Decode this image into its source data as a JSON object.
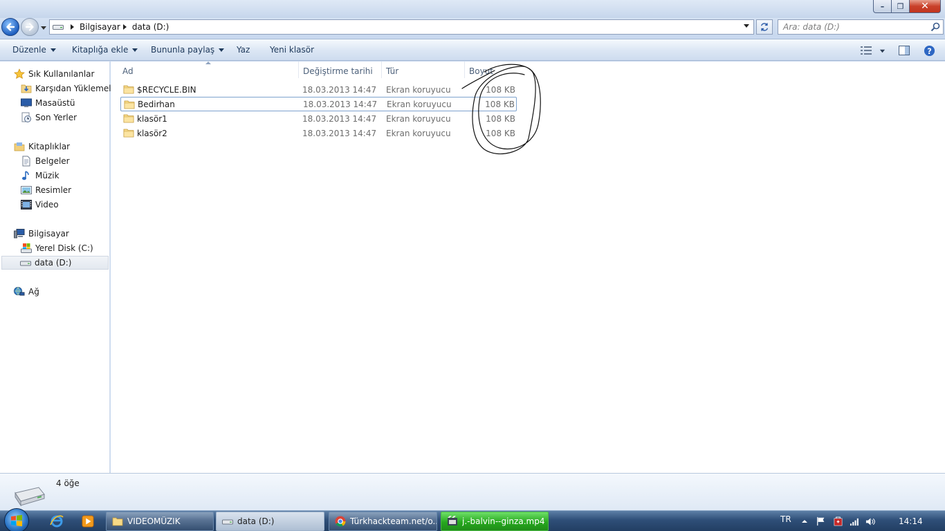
{
  "window": {
    "controls": {
      "minimize": "–",
      "maximize": "❐",
      "close": "✕"
    }
  },
  "address": {
    "crumbs": [
      "Bilgisayar",
      "data (D:)"
    ],
    "search_placeholder": "Ara: data (D:)"
  },
  "toolbar": {
    "organize": "Düzenle",
    "add_to_library": "Kitaplığa ekle",
    "share_with": "Bununla paylaş",
    "burn": "Yaz",
    "new_folder": "Yeni klasör"
  },
  "sidebar": {
    "favorites": {
      "label": "Sık Kullanılanlar",
      "items": [
        "Karşıdan Yüklemeler",
        "Masaüstü",
        "Son Yerler"
      ]
    },
    "libraries": {
      "label": "Kitaplıklar",
      "items": [
        "Belgeler",
        "Müzik",
        "Resimler",
        "Video"
      ]
    },
    "computer": {
      "label": "Bilgisayar",
      "items": [
        "Yerel Disk (C:)",
        "data (D:)"
      ]
    },
    "network": {
      "label": "Ağ"
    }
  },
  "columns": {
    "name": "Ad",
    "date_modified": "Değiştirme tarihi",
    "type": "Tür",
    "size": "Boyut"
  },
  "files": [
    {
      "name": "$RECYCLE.BIN",
      "date": "18.03.2013 14:47",
      "type": "Ekran koruyucu",
      "size": "108 KB"
    },
    {
      "name": "Bedirhan",
      "date": "18.03.2013 14:47",
      "type": "Ekran koruyucu",
      "size": "108 KB"
    },
    {
      "name": "klasör1",
      "date": "18.03.2013 14:47",
      "type": "Ekran koruyucu",
      "size": "108 KB"
    },
    {
      "name": "klasör2",
      "date": "18.03.2013 14:47",
      "type": "Ekran koruyucu",
      "size": "108 KB"
    }
  ],
  "details": {
    "item_count": "4 öğe"
  },
  "taskbar": {
    "buttons": [
      "VIDEOMÜZIK",
      "data (D:)",
      "Türkhackteam.net/o...",
      "j.-balvin--ginza.mp4"
    ],
    "language": "TR",
    "clock": "14:14"
  },
  "colors": {
    "accent": "#1f5fbf",
    "selection_border": "#7da2ce",
    "taskbar_active_green": "#27a81f"
  }
}
